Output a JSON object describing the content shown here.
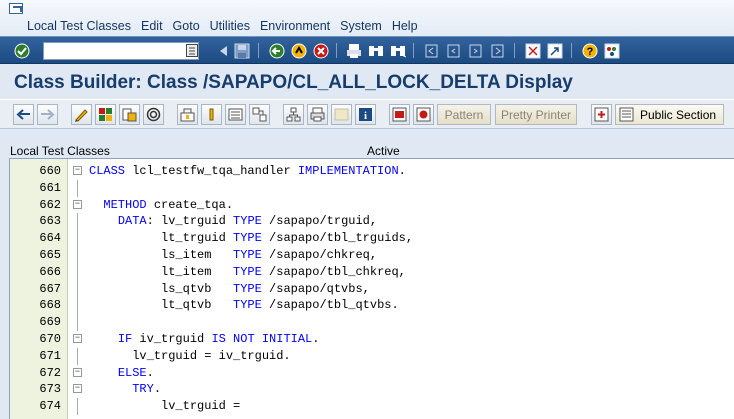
{
  "menu": {
    "items": [
      "Local Test Classes",
      "Edit",
      "Goto",
      "Utilities",
      "Environment",
      "System",
      "Help"
    ]
  },
  "std_toolbar": {
    "command_value": "",
    "icons": [
      "enter-icon",
      "save-icon",
      "back-icon",
      "exit-icon",
      "cancel-icon",
      "print-icon",
      "find-icon",
      "find-next-icon",
      "first-page-icon",
      "previous-page-icon",
      "next-page-icon",
      "last-page-icon",
      "new-session-icon",
      "shortcut-icon",
      "help-icon",
      "customize-layout-icon"
    ]
  },
  "title": "Class Builder: Class /SAPAPO/CL_ALL_LOCK_DELTA Display",
  "app_toolbar": {
    "pattern_label": "Pattern",
    "pretty_printer_label": "Pretty Printer",
    "public_section_label": "Public Section"
  },
  "status": {
    "left": "Local Test Classes",
    "state": "Active"
  },
  "editor": {
    "lines": [
      {
        "num": "660",
        "fold": "minus",
        "parts": [
          [
            "kw",
            "CLASS"
          ],
          [
            "t",
            " lcl_testfw_tqa_handler "
          ],
          [
            "kw",
            "IMPLEMENTATION"
          ],
          [
            "t",
            "."
          ]
        ]
      },
      {
        "num": "661",
        "fold": "",
        "parts": []
      },
      {
        "num": "662",
        "fold": "minus",
        "parts": [
          [
            "t",
            "  "
          ],
          [
            "kw",
            "METHOD"
          ],
          [
            "t",
            " create_tqa."
          ]
        ]
      },
      {
        "num": "663",
        "fold": "",
        "parts": [
          [
            "t",
            "    "
          ],
          [
            "kw",
            "DATA"
          ],
          [
            "t",
            ": lv_trguid "
          ],
          [
            "kw",
            "TYPE"
          ],
          [
            "t",
            " /sapapo/trguid,"
          ]
        ]
      },
      {
        "num": "664",
        "fold": "",
        "parts": [
          [
            "t",
            "          lt_trguid "
          ],
          [
            "kw",
            "TYPE"
          ],
          [
            "t",
            " /sapapo/tbl_trguids,"
          ]
        ]
      },
      {
        "num": "665",
        "fold": "",
        "parts": [
          [
            "t",
            "          ls_item   "
          ],
          [
            "kw",
            "TYPE"
          ],
          [
            "t",
            " /sapapo/chkreq,"
          ]
        ]
      },
      {
        "num": "666",
        "fold": "",
        "parts": [
          [
            "t",
            "          lt_item   "
          ],
          [
            "kw",
            "TYPE"
          ],
          [
            "t",
            " /sapapo/tbl_chkreq,"
          ]
        ]
      },
      {
        "num": "667",
        "fold": "",
        "parts": [
          [
            "t",
            "          ls_qtvb   "
          ],
          [
            "kw",
            "TYPE"
          ],
          [
            "t",
            " /sapapo/qtvbs,"
          ]
        ]
      },
      {
        "num": "668",
        "fold": "",
        "parts": [
          [
            "t",
            "          lt_qtvb   "
          ],
          [
            "kw",
            "TYPE"
          ],
          [
            "t",
            " /sapapo/tbl_qtvbs."
          ]
        ]
      },
      {
        "num": "669",
        "fold": "",
        "parts": []
      },
      {
        "num": "670",
        "fold": "minus",
        "parts": [
          [
            "t",
            "    "
          ],
          [
            "kw",
            "IF"
          ],
          [
            "t",
            " iv_trguid "
          ],
          [
            "kw",
            "IS NOT INITIAL"
          ],
          [
            "t",
            "."
          ]
        ]
      },
      {
        "num": "671",
        "fold": "",
        "parts": [
          [
            "t",
            "      lv_trguid = iv_trguid."
          ]
        ]
      },
      {
        "num": "672",
        "fold": "minus",
        "parts": [
          [
            "t",
            "    "
          ],
          [
            "kw",
            "ELSE"
          ],
          [
            "t",
            "."
          ]
        ]
      },
      {
        "num": "673",
        "fold": "minus",
        "parts": [
          [
            "t",
            "      "
          ],
          [
            "kw",
            "TRY"
          ],
          [
            "t",
            "."
          ]
        ]
      },
      {
        "num": "674",
        "fold": "",
        "parts": [
          [
            "t",
            "          lv_trguid ="
          ]
        ]
      }
    ]
  },
  "colors": {
    "keyword": "#0000ff",
    "title": "#173d6c",
    "toolbar": "#1c4a83"
  }
}
